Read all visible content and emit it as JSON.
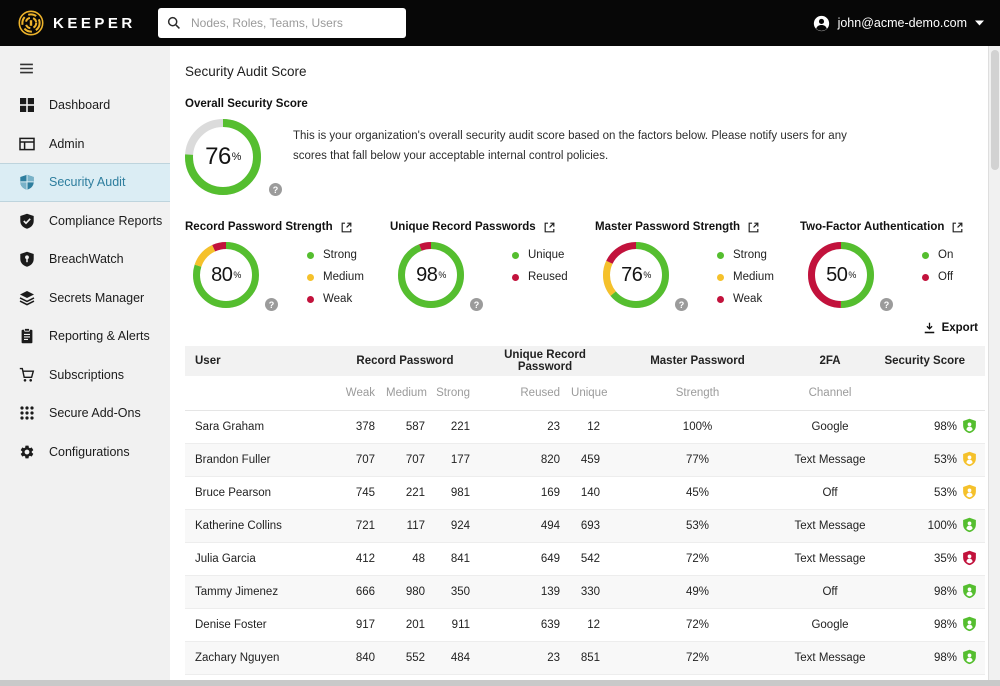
{
  "topbar": {
    "brand": "KEEPER",
    "search_placeholder": "Nodes, Roles, Teams, Users",
    "account_email": "john@acme-demo.com"
  },
  "sidebar": {
    "items": [
      {
        "label": "Dashboard",
        "icon": "dashboard",
        "active": false
      },
      {
        "label": "Admin",
        "icon": "admin",
        "active": false
      },
      {
        "label": "Security Audit",
        "icon": "security-audit",
        "active": true
      },
      {
        "label": "Compliance Reports",
        "icon": "compliance-reports",
        "active": false
      },
      {
        "label": "BreachWatch",
        "icon": "breachwatch",
        "active": false
      },
      {
        "label": "Secrets Manager",
        "icon": "secrets-manager",
        "active": false
      },
      {
        "label": "Reporting & Alerts",
        "icon": "reporting-alerts",
        "active": false
      },
      {
        "label": "Subscriptions",
        "icon": "subscriptions",
        "active": false
      },
      {
        "label": "Secure Add-Ons",
        "icon": "secure-addons",
        "active": false
      },
      {
        "label": "Configurations",
        "icon": "configurations",
        "active": false
      }
    ]
  },
  "page": {
    "title": "Security Audit Score",
    "export_label": "Export"
  },
  "overall": {
    "title": "Overall Security Score",
    "value": "76",
    "unit": "%",
    "description": "This is your organization's overall security audit score based on the factors below. Please notify users for any scores that fall below your acceptable internal control policies.",
    "segments": [
      {
        "color": "green",
        "value": 76
      }
    ]
  },
  "metrics": [
    {
      "title": "Record Password Strength",
      "value": "80",
      "unit": "%",
      "segments": [
        {
          "color": "green",
          "value": 80
        },
        {
          "color": "yellow",
          "value": 13
        },
        {
          "color": "red",
          "value": 7
        }
      ],
      "legend": [
        {
          "label": "Strong",
          "color": "green"
        },
        {
          "label": "Medium",
          "color": "yellow"
        },
        {
          "label": "Weak",
          "color": "red"
        }
      ]
    },
    {
      "title": "Unique Record Passwords",
      "value": "98",
      "unit": "%",
      "segments": [
        {
          "color": "green",
          "value": 94
        },
        {
          "color": "red",
          "value": 6
        }
      ],
      "legend": [
        {
          "label": "Unique",
          "color": "green"
        },
        {
          "label": "Reused",
          "color": "red"
        }
      ]
    },
    {
      "title": "Master Password Strength",
      "value": "76",
      "unit": "%",
      "segments": [
        {
          "color": "green",
          "value": 64
        },
        {
          "color": "yellow",
          "value": 18
        },
        {
          "color": "red",
          "value": 18
        }
      ],
      "legend": [
        {
          "label": "Strong",
          "color": "green"
        },
        {
          "label": "Medium",
          "color": "yellow"
        },
        {
          "label": "Weak",
          "color": "red"
        }
      ]
    },
    {
      "title": "Two-Factor Authentication",
      "value": "50",
      "unit": "%",
      "segments": [
        {
          "color": "green",
          "value": 50
        },
        {
          "color": "red",
          "value": 50
        }
      ],
      "legend": [
        {
          "label": "On",
          "color": "green"
        },
        {
          "label": "Off",
          "color": "red"
        }
      ]
    }
  ],
  "table": {
    "groups": [
      {
        "label": "User",
        "span": 1
      },
      {
        "label": "Record Password",
        "span": 3
      },
      {
        "label": "Unique Record Password",
        "span": 2
      },
      {
        "label": "Master Password",
        "span": 1
      },
      {
        "label": "2FA",
        "span": 1
      },
      {
        "label": "Security Score",
        "span": 1
      }
    ],
    "subheaders": [
      "",
      "Weak",
      "Medium",
      "Strong",
      "Reused",
      "Unique",
      "Strength",
      "Channel",
      ""
    ],
    "rows": [
      {
        "user": "Sara Graham",
        "weak": "378",
        "medium": "587",
        "strong": "221",
        "reused": "23",
        "unique": "12",
        "strength": "100%",
        "channel": "Google",
        "score": "98%",
        "badge": "green"
      },
      {
        "user": "Brandon Fuller",
        "weak": "707",
        "medium": "707",
        "strong": "177",
        "reused": "820",
        "unique": "459",
        "strength": "77%",
        "channel": "Text Message",
        "score": "53%",
        "badge": "yellow"
      },
      {
        "user": "Bruce Pearson",
        "weak": "745",
        "medium": "221",
        "strong": "981",
        "reused": "169",
        "unique": "140",
        "strength": "45%",
        "channel": "Off",
        "score": "53%",
        "badge": "yellow"
      },
      {
        "user": "Katherine Collins",
        "weak": "721",
        "medium": "117",
        "strong": "924",
        "reused": "494",
        "unique": "693",
        "strength": "53%",
        "channel": "Text Message",
        "score": "100%",
        "badge": "green"
      },
      {
        "user": "Julia Garcia",
        "weak": "412",
        "medium": "48",
        "strong": "841",
        "reused": "649",
        "unique": "542",
        "strength": "72%",
        "channel": "Text Message",
        "score": "35%",
        "badge": "red"
      },
      {
        "user": "Tammy Jimenez",
        "weak": "666",
        "medium": "980",
        "strong": "350",
        "reused": "139",
        "unique": "330",
        "strength": "49%",
        "channel": "Off",
        "score": "98%",
        "badge": "green"
      },
      {
        "user": "Denise Foster",
        "weak": "917",
        "medium": "201",
        "strong": "911",
        "reused": "639",
        "unique": "12",
        "strength": "72%",
        "channel": "Google",
        "score": "98%",
        "badge": "green"
      },
      {
        "user": "Zachary Nguyen",
        "weak": "840",
        "medium": "552",
        "strong": "484",
        "reused": "23",
        "unique": "851",
        "strength": "72%",
        "channel": "Text Message",
        "score": "98%",
        "badge": "green"
      }
    ]
  },
  "colors": {
    "green": "#55BE2F",
    "yellow": "#F5C12B",
    "red": "#C2123C",
    "track": "#DBDBDB",
    "gold": "#EDB32B",
    "link_blue": "#3AA7C9",
    "active_blue": "#2E7E9E"
  }
}
